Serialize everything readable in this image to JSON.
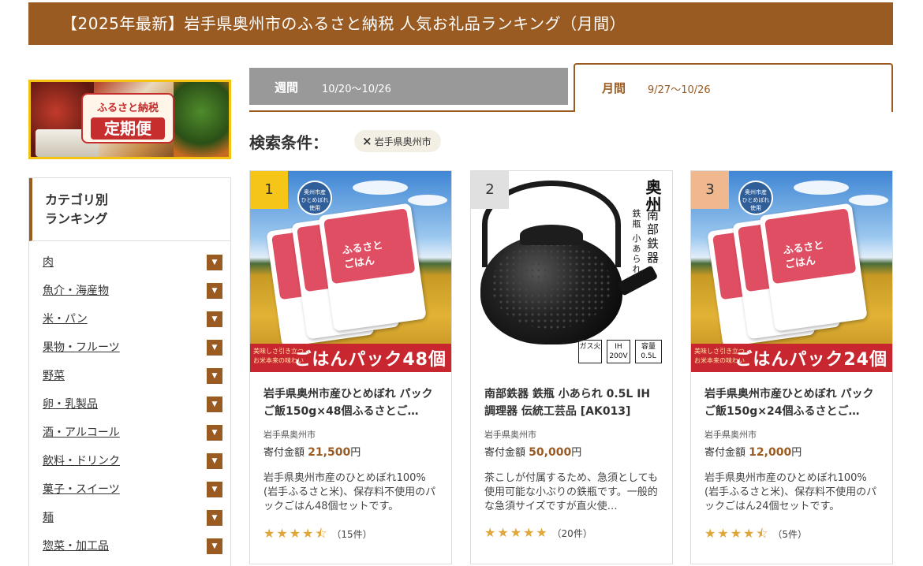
{
  "header": {
    "title": "【2025年最新】岩手県奥州市のふるさと納税 人気お礼品ランキング（月間）"
  },
  "banner": {
    "line1": "ふるさと納税",
    "line2": "定期便"
  },
  "sidebar": {
    "title_line1": "カテゴリ別",
    "title_line2": "ランキング",
    "items": [
      {
        "label": "肉"
      },
      {
        "label": "魚介・海産物"
      },
      {
        "label": "米・パン"
      },
      {
        "label": "果物・フルーツ"
      },
      {
        "label": "野菜"
      },
      {
        "label": "卵・乳製品"
      },
      {
        "label": "酒・アルコール"
      },
      {
        "label": "飲料・ドリンク"
      },
      {
        "label": "菓子・スイーツ"
      },
      {
        "label": "麺"
      },
      {
        "label": "惣菜・加工品"
      }
    ],
    "drop_glyph": "▼"
  },
  "tabs": {
    "weekly": {
      "label": "週間",
      "range": "10/20〜10/26"
    },
    "monthly": {
      "label": "月間",
      "range": "9/27〜10/26"
    }
  },
  "search": {
    "label": "検索条件：",
    "chip_x": "×",
    "chip_label": "岩手県奥州市"
  },
  "cards": [
    {
      "rank": "1",
      "name": "岩手県奥州市産ひとめぼれ パックご飯150g×48個ふるさとご…",
      "region": "岩手県奥州市",
      "price_label": "寄付金額",
      "price": "21,500",
      "yen": "円",
      "description": "岩手県奥州市産のひとめぼれ100%(岩手ふるさと米)、保存料不使用のパックごはん48個セットです。",
      "stars": "★★★★⯪",
      "rating": 4.5,
      "reviews": "（15件）",
      "image": {
        "band_small": "美味しさ引き立つ\nお米本来の味わい",
        "band_large": "ごはんパック48個",
        "pack_text": "ふるさと\nごはん",
        "seal": "奥州市産\nひとめぼれ\n使用"
      }
    },
    {
      "rank": "2",
      "name": "南部鉄器 鉄瓶 小あられ 0.5L IH調理器 伝統工芸品 [AK013]",
      "region": "岩手県奥州市",
      "price_label": "寄付金額",
      "price": "50,000",
      "yen": "円",
      "description": "茶こしが付属するため、急須としても使用可能な小ぶりの鉄瓶です。一般的な急須サイズですが直火使…",
      "stars": "★★★★★",
      "rating": 5,
      "reviews": "（20件）",
      "image": {
        "brand": "奥州",
        "sub1": "南部鉄器",
        "sub2": "鉄瓶 小あられ",
        "spec1": "ガス火",
        "spec2": "IH\n200V",
        "spec3": "容量\n0.5L"
      }
    },
    {
      "rank": "3",
      "name": "岩手県奥州市産ひとめぼれ パックご飯150g×24個ふるさとご…",
      "region": "岩手県奥州市",
      "price_label": "寄付金額",
      "price": "12,000",
      "yen": "円",
      "description": "岩手県奥州市産のひとめぼれ100%(岩手ふるさと米)、保存料不使用のパックごはん24個セットです。",
      "stars": "★★★★⯪",
      "rating": 4.5,
      "reviews": "（5件）",
      "image": {
        "band_small": "美味しさ引き立つ\nお米本来の味わい",
        "band_large": "ごはんパック24個",
        "pack_text": "ふるさと\nごはん",
        "seal": "奥州市産\nひとめぼれ\n使用"
      }
    }
  ],
  "colors": {
    "brand": "#9a5b22",
    "gold": "#f5c518",
    "silver": "#e0e0e0",
    "bronze": "#efb88e",
    "star": "#e0a63a"
  }
}
